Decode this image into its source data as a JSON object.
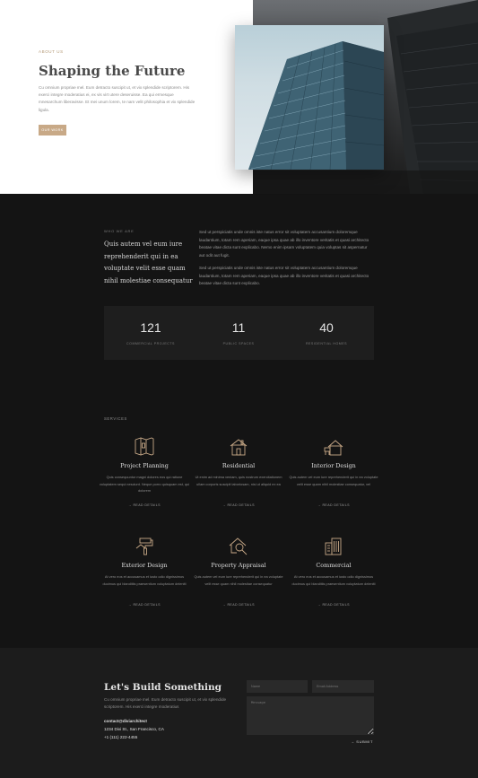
{
  "hero": {
    "eyebrow": "ABOUT US",
    "title": "Shaping the Future",
    "text": "Cu omnium propriae mel. Eum detracto suscipit ut, et vix splendide scriptorem. His exerci integre moderatius ei, ex vis virt utere deseruisse. Ea qui ermesque mnesarchum liberavisse. Et mei unum lorem, te nam velit philosophia et vix splendide ligula.",
    "button_label": "OUR WORK"
  },
  "who": {
    "eyebrow": "WHO WE ARE",
    "quote": "Quis autem vel eum iure reprehenderit qui in ea voluptate velit esse quam nihil molestiae consequatur",
    "paragraph_1": "Sed ut perspiciatis unde omnis iste natus error sit voluptatem accusantium doloremque laudantium, totam rem aperiam, eaque ipsa quae ab illo inventore veritatis et quasi architecto beatae vitae dicta sunt explicabo. Nemo enim ipsam voluptatem quia voluptas sit aspernatur aut odit aut fugit.",
    "paragraph_2": "Sed ut perspiciatis unde omnis iste natus error sit voluptatem accusantium doloremque laudantium, totam rem aperiam, eaque ipsa quae ab illo inventore veritatis et quasi architecto beatae vitae dicta sunt explicabo."
  },
  "stats": [
    {
      "value": "121",
      "label": "COMMERCIAL PROJECTS"
    },
    {
      "value": "11",
      "label": "PUBLIC SPACES"
    },
    {
      "value": "40",
      "label": "RESIDENTIAL HOMES"
    }
  ],
  "services": {
    "label": "SERVICES",
    "link_label": "→ READ DETAILS",
    "items": [
      {
        "title": "Project Planning",
        "icon": "blueprint-icon",
        "desc": "Quis consequuntur magni dolores eos qui ratione voluptatem sequi nesciunt. Neque porro quisquam est, qui dolorem"
      },
      {
        "title": "Residential",
        "icon": "house-icon",
        "desc": "Ut enim ad minima veniam, quis nostrum exercitationem ullam corporis suscipit laboriosam, nisi ut aliquid ex ea"
      },
      {
        "title": "Interior Design",
        "icon": "interior-icon",
        "desc": "Quis autem vel eum iure reprehenderit qui in ea voluptate velit esse quam nihil molestiae consequatur, vel"
      },
      {
        "title": "Exterior Design",
        "icon": "paint-roller-icon",
        "desc": "At vero eos et accusamus et iusto odio dignissimos ducimus qui blanditiis praesentium voluptatum deleniti"
      },
      {
        "title": "Property Appraisal",
        "icon": "house-search-icon",
        "desc": "Quis autem vel eum iure reprehenderit qui in ea voluptate velit esse quam nihil molestiae consequatur"
      },
      {
        "title": "Commercial",
        "icon": "buildings-icon",
        "desc": "At vero eos et accusamus et iusto odio dignissimos ducimus qui blanditiis praesentium voluptatum deleniti"
      }
    ]
  },
  "contact": {
    "title": "Let's Build Something",
    "text": "Cu omnium propriae mel. Eum detracto suscipit ut, et vix splendide scriptorem. His exerci integre moderatius",
    "email": "contact@diviarchitect",
    "address": "1234 Divi St., San Francisco, CA",
    "phone": "+1 (111) 222-4455",
    "name_placeholder": "Name",
    "email_placeholder": "Email Address",
    "message_placeholder": "Message",
    "submit_label": "→ SUBMIT"
  },
  "colors": {
    "accent": "#c8a987",
    "background": "#141414",
    "panel": "#1e1e1e"
  }
}
